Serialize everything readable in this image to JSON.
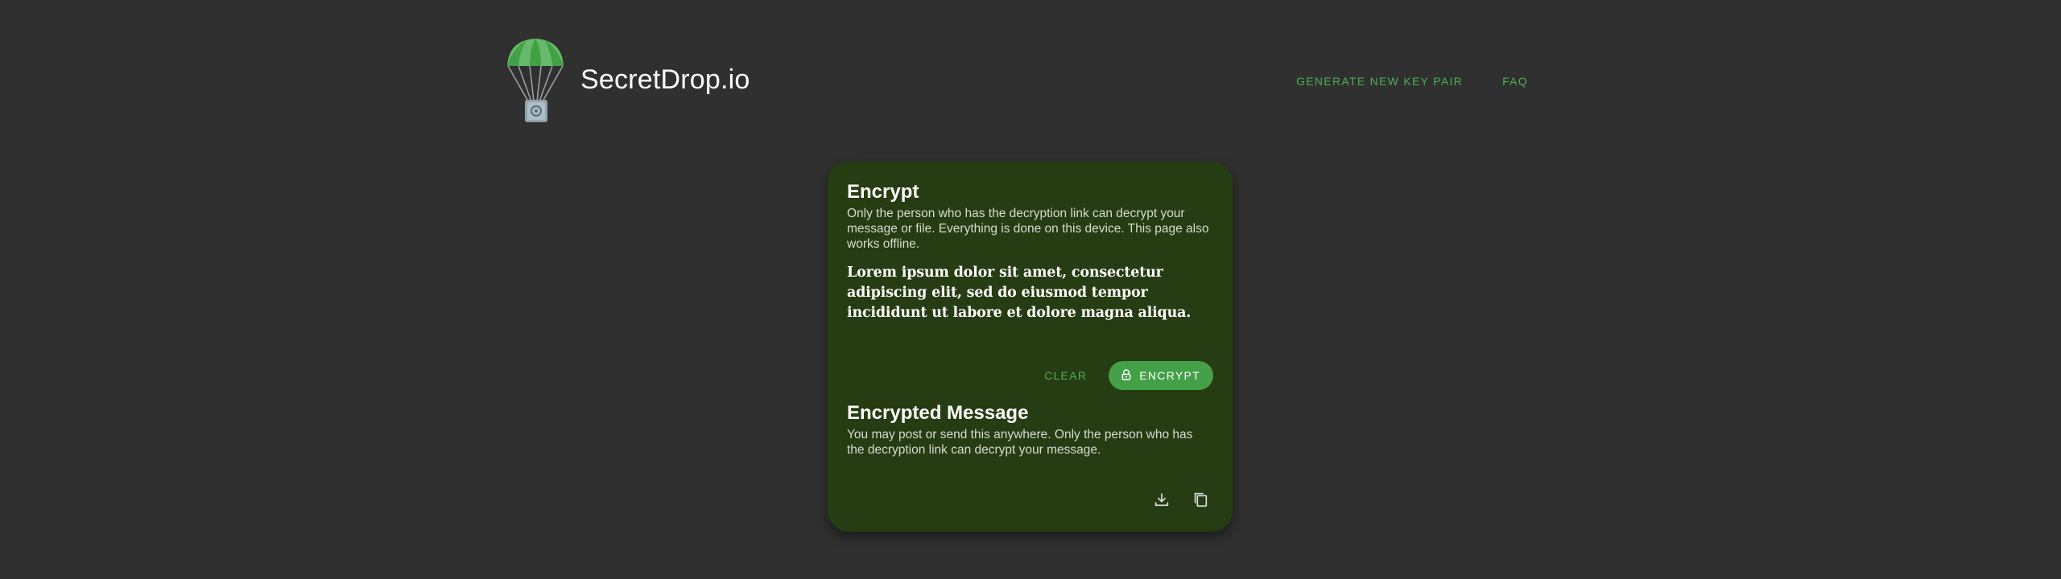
{
  "header": {
    "brand": "SecretDrop.io",
    "logo_icon": "parachute-lock-icon",
    "nav": [
      {
        "label": "GENERATE NEW KEY PAIR"
      },
      {
        "label": "FAQ"
      }
    ]
  },
  "encrypt": {
    "title": "Encrypt",
    "description": "Only the person who has the decryption link can decrypt your message or file. Everything is done on this device. This page also works offline.",
    "message": "Lorem ipsum dolor sit amet, consectetur adipiscing elit, sed do eiusmod tempor incididunt ut labore et dolore magna aliqua.",
    "clear_label": "CLEAR",
    "encrypt_label": "ENCRYPT",
    "encrypt_icon": "lock-icon"
  },
  "encrypted": {
    "title": "Encrypted Message",
    "description": "You may post or send this anywhere. Only the person who has the decryption link can decrypt your message.",
    "download_icon": "download-icon",
    "copy_icon": "copy-icon"
  },
  "colors": {
    "background": "#303030",
    "card": "#263c12",
    "accent": "#4caf50",
    "button": "#43a047"
  }
}
